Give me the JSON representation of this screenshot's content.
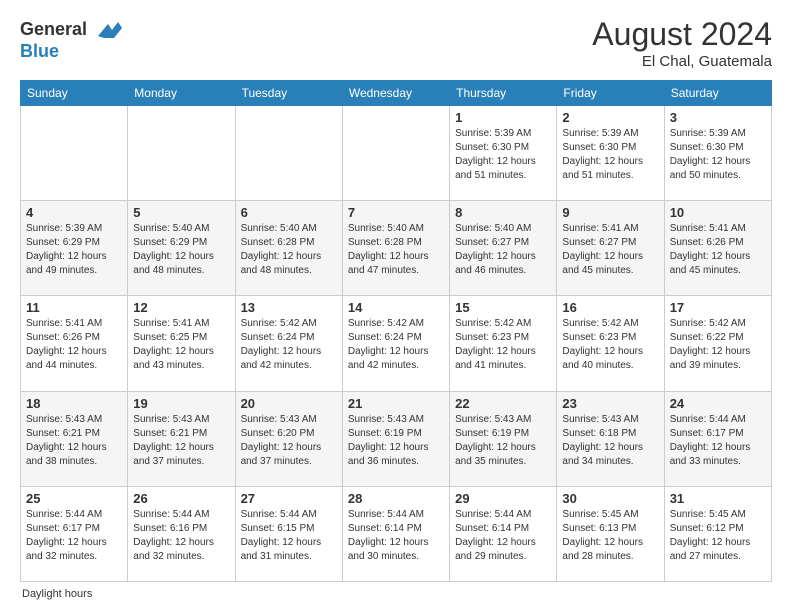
{
  "header": {
    "logo_line1": "General",
    "logo_line2": "Blue",
    "month_year": "August 2024",
    "location": "El Chal, Guatemala"
  },
  "days_of_week": [
    "Sunday",
    "Monday",
    "Tuesday",
    "Wednesday",
    "Thursday",
    "Friday",
    "Saturday"
  ],
  "weeks": [
    [
      {
        "num": "",
        "info": ""
      },
      {
        "num": "",
        "info": ""
      },
      {
        "num": "",
        "info": ""
      },
      {
        "num": "",
        "info": ""
      },
      {
        "num": "1",
        "info": "Sunrise: 5:39 AM\nSunset: 6:30 PM\nDaylight: 12 hours\nand 51 minutes."
      },
      {
        "num": "2",
        "info": "Sunrise: 5:39 AM\nSunset: 6:30 PM\nDaylight: 12 hours\nand 51 minutes."
      },
      {
        "num": "3",
        "info": "Sunrise: 5:39 AM\nSunset: 6:30 PM\nDaylight: 12 hours\nand 50 minutes."
      }
    ],
    [
      {
        "num": "4",
        "info": "Sunrise: 5:39 AM\nSunset: 6:29 PM\nDaylight: 12 hours\nand 49 minutes."
      },
      {
        "num": "5",
        "info": "Sunrise: 5:40 AM\nSunset: 6:29 PM\nDaylight: 12 hours\nand 48 minutes."
      },
      {
        "num": "6",
        "info": "Sunrise: 5:40 AM\nSunset: 6:28 PM\nDaylight: 12 hours\nand 48 minutes."
      },
      {
        "num": "7",
        "info": "Sunrise: 5:40 AM\nSunset: 6:28 PM\nDaylight: 12 hours\nand 47 minutes."
      },
      {
        "num": "8",
        "info": "Sunrise: 5:40 AM\nSunset: 6:27 PM\nDaylight: 12 hours\nand 46 minutes."
      },
      {
        "num": "9",
        "info": "Sunrise: 5:41 AM\nSunset: 6:27 PM\nDaylight: 12 hours\nand 45 minutes."
      },
      {
        "num": "10",
        "info": "Sunrise: 5:41 AM\nSunset: 6:26 PM\nDaylight: 12 hours\nand 45 minutes."
      }
    ],
    [
      {
        "num": "11",
        "info": "Sunrise: 5:41 AM\nSunset: 6:26 PM\nDaylight: 12 hours\nand 44 minutes."
      },
      {
        "num": "12",
        "info": "Sunrise: 5:41 AM\nSunset: 6:25 PM\nDaylight: 12 hours\nand 43 minutes."
      },
      {
        "num": "13",
        "info": "Sunrise: 5:42 AM\nSunset: 6:24 PM\nDaylight: 12 hours\nand 42 minutes."
      },
      {
        "num": "14",
        "info": "Sunrise: 5:42 AM\nSunset: 6:24 PM\nDaylight: 12 hours\nand 42 minutes."
      },
      {
        "num": "15",
        "info": "Sunrise: 5:42 AM\nSunset: 6:23 PM\nDaylight: 12 hours\nand 41 minutes."
      },
      {
        "num": "16",
        "info": "Sunrise: 5:42 AM\nSunset: 6:23 PM\nDaylight: 12 hours\nand 40 minutes."
      },
      {
        "num": "17",
        "info": "Sunrise: 5:42 AM\nSunset: 6:22 PM\nDaylight: 12 hours\nand 39 minutes."
      }
    ],
    [
      {
        "num": "18",
        "info": "Sunrise: 5:43 AM\nSunset: 6:21 PM\nDaylight: 12 hours\nand 38 minutes."
      },
      {
        "num": "19",
        "info": "Sunrise: 5:43 AM\nSunset: 6:21 PM\nDaylight: 12 hours\nand 37 minutes."
      },
      {
        "num": "20",
        "info": "Sunrise: 5:43 AM\nSunset: 6:20 PM\nDaylight: 12 hours\nand 37 minutes."
      },
      {
        "num": "21",
        "info": "Sunrise: 5:43 AM\nSunset: 6:19 PM\nDaylight: 12 hours\nand 36 minutes."
      },
      {
        "num": "22",
        "info": "Sunrise: 5:43 AM\nSunset: 6:19 PM\nDaylight: 12 hours\nand 35 minutes."
      },
      {
        "num": "23",
        "info": "Sunrise: 5:43 AM\nSunset: 6:18 PM\nDaylight: 12 hours\nand 34 minutes."
      },
      {
        "num": "24",
        "info": "Sunrise: 5:44 AM\nSunset: 6:17 PM\nDaylight: 12 hours\nand 33 minutes."
      }
    ],
    [
      {
        "num": "25",
        "info": "Sunrise: 5:44 AM\nSunset: 6:17 PM\nDaylight: 12 hours\nand 32 minutes."
      },
      {
        "num": "26",
        "info": "Sunrise: 5:44 AM\nSunset: 6:16 PM\nDaylight: 12 hours\nand 32 minutes."
      },
      {
        "num": "27",
        "info": "Sunrise: 5:44 AM\nSunset: 6:15 PM\nDaylight: 12 hours\nand 31 minutes."
      },
      {
        "num": "28",
        "info": "Sunrise: 5:44 AM\nSunset: 6:14 PM\nDaylight: 12 hours\nand 30 minutes."
      },
      {
        "num": "29",
        "info": "Sunrise: 5:44 AM\nSunset: 6:14 PM\nDaylight: 12 hours\nand 29 minutes."
      },
      {
        "num": "30",
        "info": "Sunrise: 5:45 AM\nSunset: 6:13 PM\nDaylight: 12 hours\nand 28 minutes."
      },
      {
        "num": "31",
        "info": "Sunrise: 5:45 AM\nSunset: 6:12 PM\nDaylight: 12 hours\nand 27 minutes."
      }
    ]
  ],
  "footer": {
    "note": "Daylight hours"
  }
}
